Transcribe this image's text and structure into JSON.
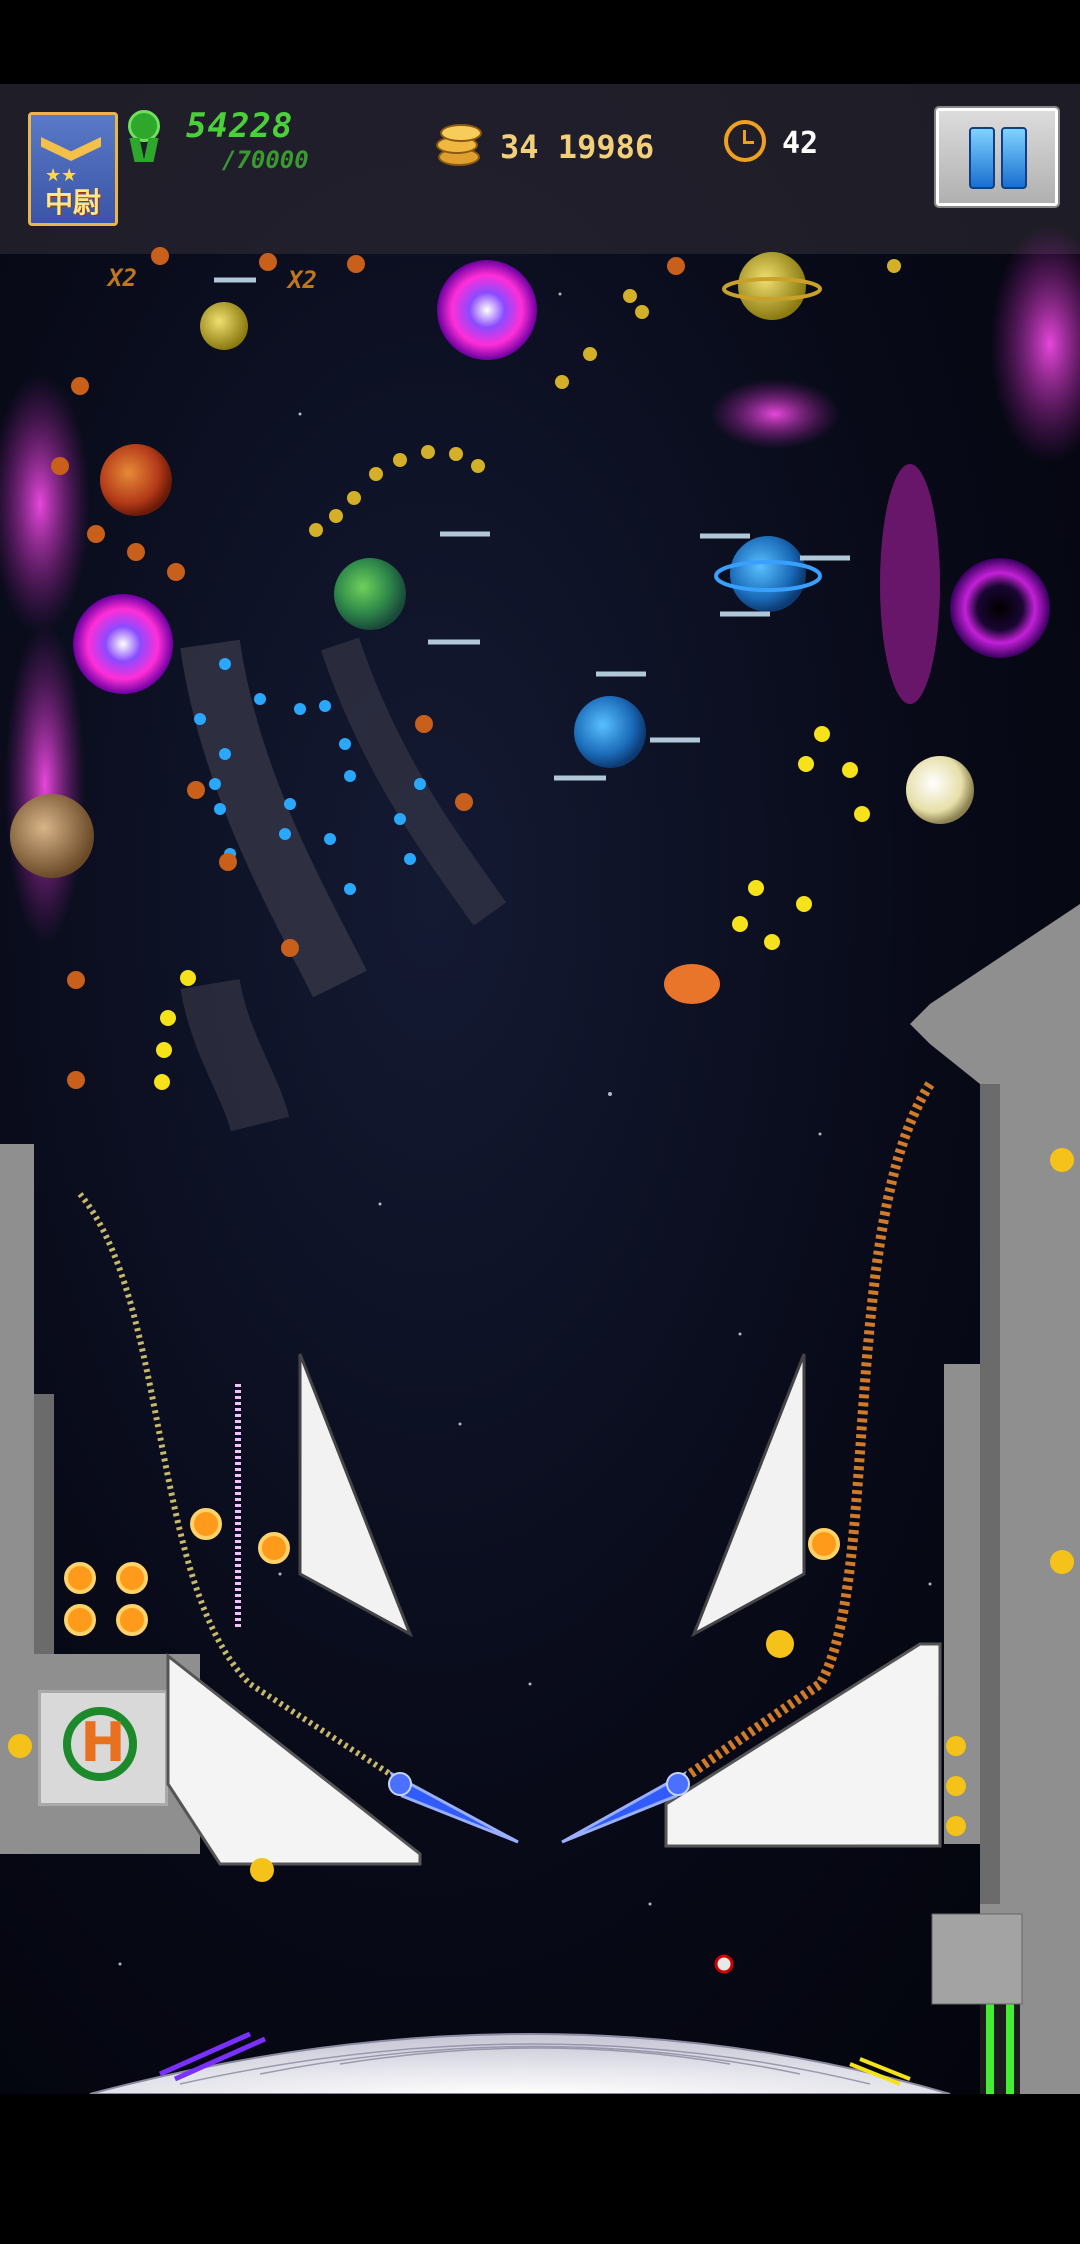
{
  "hud": {
    "rank_label": "中尉",
    "score": "54228",
    "score_goal": "/70000",
    "coins": "34 19986",
    "timer": "42"
  },
  "multipliers": [
    "X2",
    "X2"
  ],
  "icons": {
    "rank": "rank-insignia-icon",
    "score": "ribbon-award-icon",
    "coins": "coin-stack-icon",
    "timer": "alarm-clock-icon",
    "pause": "pause-icon"
  },
  "colors": {
    "score_green": "#4ad13a",
    "coin_gold": "#f2d07a",
    "nebula_magenta": "#d62fc8",
    "flipper_blue": "#2f5bff",
    "bumper_orange": "#ff9a1a"
  }
}
